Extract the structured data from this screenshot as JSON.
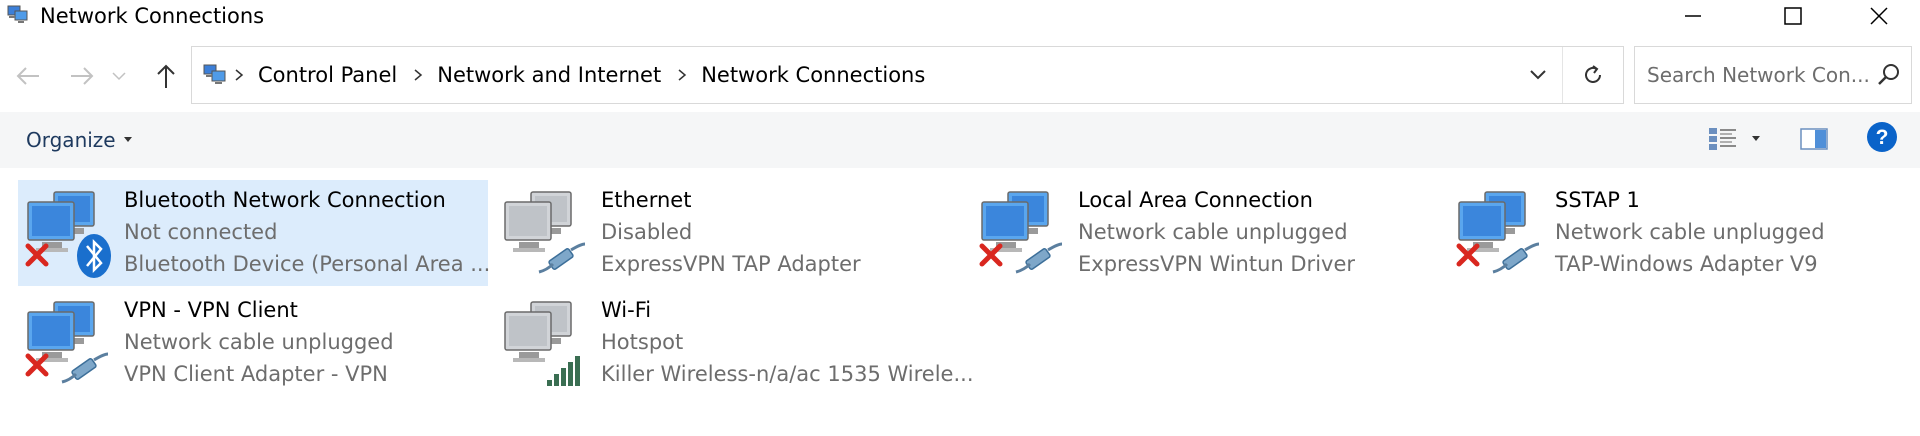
{
  "window": {
    "title": "Network Connections"
  },
  "breadcrumb": {
    "items": [
      "Control Panel",
      "Network and Internet",
      "Network Connections"
    ]
  },
  "search": {
    "placeholder": "Search Network Con..."
  },
  "toolbar": {
    "organize_label": "Organize"
  },
  "connections": [
    {
      "name": "Bluetooth Network Connection",
      "status": "Not connected",
      "device": "Bluetooth Device (Personal Area ...",
      "selected": true,
      "overlay": "bluetooth",
      "error": true
    },
    {
      "name": "Ethernet",
      "status": "Disabled",
      "device": "ExpressVPN TAP Adapter",
      "selected": false,
      "overlay": "cable",
      "error": false,
      "disabled": true
    },
    {
      "name": "Local Area Connection",
      "status": "Network cable unplugged",
      "device": "ExpressVPN Wintun Driver",
      "selected": false,
      "overlay": "cable",
      "error": true
    },
    {
      "name": "SSTAP 1",
      "status": "Network cable unplugged",
      "device": "TAP-Windows Adapter V9",
      "selected": false,
      "overlay": "cable",
      "error": true
    },
    {
      "name": "VPN - VPN Client",
      "status": "Network cable unplugged",
      "device": "VPN Client Adapter - VPN",
      "selected": false,
      "overlay": "cable",
      "error": true
    },
    {
      "name": "Wi-Fi",
      "status": "Hotspot",
      "device": "Killer Wireless-n/a/ac 1535 Wirele...",
      "selected": false,
      "overlay": "wifi",
      "error": false,
      "disabled": true
    }
  ],
  "colors": {
    "selection": "#dcecfc",
    "toolbar_bg": "#f5f6f7",
    "error_red": "#d9271f",
    "help_blue": "#0a63c9"
  }
}
